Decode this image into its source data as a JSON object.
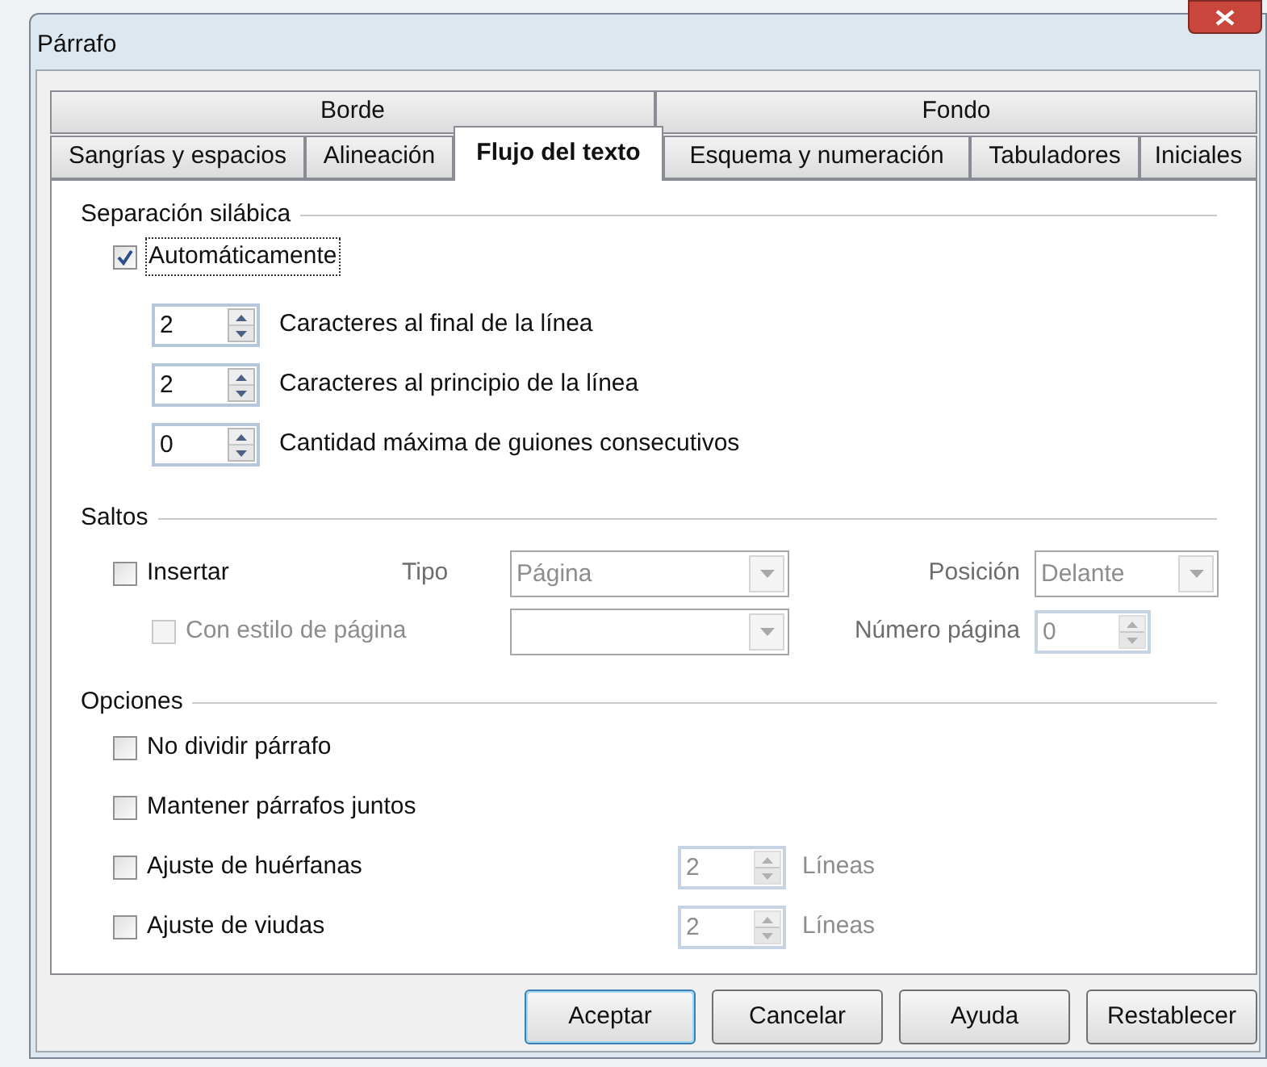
{
  "window": {
    "title": "Párrafo"
  },
  "tabs": [
    [
      {
        "label": "Borde",
        "selected": false
      },
      {
        "label": "Fondo",
        "selected": false
      }
    ],
    [
      {
        "label": "Sangrías y espacios",
        "selected": false
      },
      {
        "label": "Alineación",
        "selected": false
      },
      {
        "label": "Flujo del texto",
        "selected": true
      },
      {
        "label": "Esquema y numeración",
        "selected": false
      },
      {
        "label": "Tabuladores",
        "selected": false
      },
      {
        "label": "Iniciales",
        "selected": false
      }
    ]
  ],
  "hyphenation": {
    "title": "Separación silábica",
    "automatic": {
      "label": "Automáticamente",
      "checked": true,
      "focused": true
    },
    "spinners": [
      {
        "value": "2",
        "label": "Caracteres al final de la línea"
      },
      {
        "value": "2",
        "label": "Caracteres al principio de la línea"
      },
      {
        "value": "0",
        "label": "Cantidad máxima de guiones consecutivos"
      }
    ]
  },
  "breaks": {
    "title": "Saltos",
    "insert": {
      "label": "Insertar",
      "checked": false
    },
    "type": {
      "label": "Tipo",
      "value": "Página",
      "disabled": true
    },
    "position": {
      "label": "Posición",
      "value": "Delante",
      "disabled": true
    },
    "page_style": {
      "label": "Con estilo de página",
      "checked": false,
      "disabled": true
    },
    "page_style_select": {
      "disabled": true
    },
    "page_number": {
      "label": "Número página",
      "value": "0",
      "disabled": true
    }
  },
  "options": {
    "title": "Opciones",
    "items": [
      {
        "label": "No dividir párrafo",
        "checked": false
      },
      {
        "label": "Mantener párrafos juntos",
        "checked": false
      },
      {
        "label": "Ajuste de huérfanas",
        "checked": false,
        "spinner": {
          "value": "2",
          "unit": "Líneas",
          "disabled": true
        }
      },
      {
        "label": "Ajuste de viudas",
        "checked": false,
        "spinner": {
          "value": "2",
          "unit": "Líneas",
          "disabled": true
        }
      }
    ]
  },
  "buttons": [
    {
      "label": "Aceptar",
      "default": true
    },
    {
      "label": "Cancelar",
      "default": false
    },
    {
      "label": "Ayuda",
      "default": false
    },
    {
      "label": "Restablecer",
      "default": false
    }
  ]
}
